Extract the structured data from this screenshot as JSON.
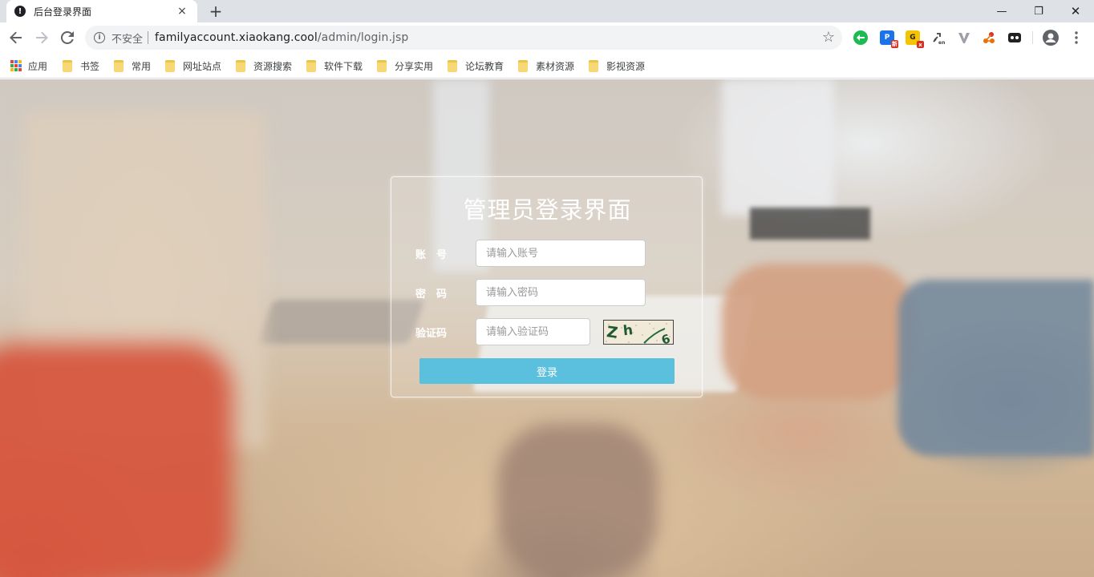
{
  "browser": {
    "tab_title": "后台登录界面",
    "tab_close": "×",
    "new_tab": "+",
    "security_label": "不安全",
    "url_host": "familyaccount.xiaokang.cool",
    "url_path": "/admin/login.jsp",
    "window_controls": {
      "minimize": "—",
      "restore": "❐",
      "close": "✕"
    }
  },
  "bookmarks": {
    "items": [
      {
        "label": "应用",
        "icon": "apps-grid-icon"
      },
      {
        "label": "书签",
        "icon": "folder-icon"
      },
      {
        "label": "常用",
        "icon": "folder-icon"
      },
      {
        "label": "网址站点",
        "icon": "folder-icon"
      },
      {
        "label": "资源搜索",
        "icon": "folder-icon"
      },
      {
        "label": "软件下载",
        "icon": "folder-icon"
      },
      {
        "label": "分享实用",
        "icon": "folder-icon"
      },
      {
        "label": "论坛教育",
        "icon": "folder-icon"
      },
      {
        "label": "素材资源",
        "icon": "folder-icon"
      },
      {
        "label": "影视资源",
        "icon": "folder-icon"
      }
    ]
  },
  "extensions": [
    {
      "name": "green-circle-extension-icon",
      "color": "#1db954"
    },
    {
      "name": "p-extension-icon",
      "color": "#1a73e8",
      "text": "P"
    },
    {
      "name": "g-extension-icon",
      "color": "#f5c400",
      "text": "G"
    },
    {
      "name": "link-extension-icon",
      "color": "#5f6368"
    },
    {
      "name": "v-extension-icon",
      "color": "#9aa0a6"
    },
    {
      "name": "network-extension-icon",
      "color": "#e8710a"
    },
    {
      "name": "mask-extension-icon",
      "color": "#202124"
    }
  ],
  "login": {
    "title": "管理员登录界面",
    "account_label": "账　号",
    "account_placeholder": "请输入账号",
    "password_label": "密　码",
    "password_placeholder": "请输入密码",
    "captcha_label": "验证码",
    "captcha_placeholder": "请输入验证码",
    "captcha_text": "Zh 6",
    "submit_label": "登录",
    "button_color": "#5bc0de"
  }
}
